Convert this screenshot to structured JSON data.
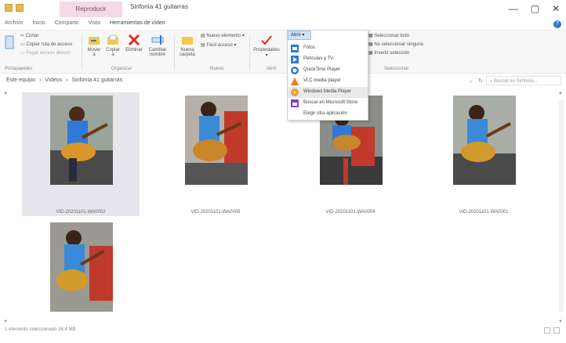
{
  "title_bar": {
    "context_tab": "Reproducir",
    "title": "Sinfonía 41 guitarras",
    "controls": [
      "—",
      "▢",
      "✕"
    ]
  },
  "ribbon_tabs": [
    "Archivo",
    "Inicio",
    "Compartir",
    "Vista",
    "Herramientas de vídeo"
  ],
  "ribbon": {
    "clipboard": {
      "cortar": "Cortar",
      "copiar_ruta": "Copiar ruta de acceso",
      "pegar_acceso": "Pegar acceso directo",
      "pegar": "Pegar",
      "group": "Portapapeles"
    },
    "organize": {
      "mover_a": "Mover a",
      "copiar_a": "Copiar a",
      "eliminar": "Eliminar",
      "cambiar_nombre": "Cambiar nombre",
      "group": "Organizar"
    },
    "new": {
      "nueva_carpeta": "Nueva carpeta",
      "nuevo_elemento": "Nuevo elemento",
      "facil_acceso": "Fácil acceso",
      "group": "Nuevo"
    },
    "open": {
      "propiedades": "Propiedades",
      "abrir": "Abrir",
      "group": "Abrir"
    },
    "select": {
      "seleccionar_todo": "Seleccionar todo",
      "no_seleccionar": "No seleccionar ninguno",
      "invertir": "Invertir selección",
      "group": "Seleccionar"
    }
  },
  "address_bar": {
    "crumbs": [
      "Este equipo",
      "›",
      "Vídeos",
      "›",
      "Sinfonía 41 guitarras"
    ],
    "search_placeholder": "Buscar en Sinfonía..."
  },
  "open_menu": {
    "items": [
      {
        "label": "Fotos",
        "icon": "photos-icon"
      },
      {
        "label": "Películas y TV",
        "icon": "movies-tv-icon"
      },
      {
        "label": "QuickTime Player",
        "icon": "quicktime-icon"
      },
      {
        "label": "VLC media player",
        "icon": "vlc-icon"
      },
      {
        "label": "Windows Media Player",
        "icon": "wmp-icon"
      },
      {
        "label": "Buscar en Microsoft Store",
        "icon": "store-icon"
      },
      {
        "label": "Elegir otra aplicación",
        "icon": ""
      }
    ]
  },
  "files": [
    {
      "name": "VID-20201101-WA0002",
      "selected": true
    },
    {
      "name": "VID-20201101-WA0005",
      "selected": false
    },
    {
      "name": "VID-20201101-WA0004",
      "selected": false
    },
    {
      "name": "VID-20201101-WA0001",
      "selected": false
    },
    {
      "name": "VID-20201101-WA0003",
      "selected": false
    }
  ],
  "status_bar": {
    "text": "1 elemento seleccionado 38,4 MB"
  },
  "colors": {
    "context_tab": "#f6d9e6",
    "selection": "#e6e6ec",
    "accent": "#2a7bd4"
  }
}
